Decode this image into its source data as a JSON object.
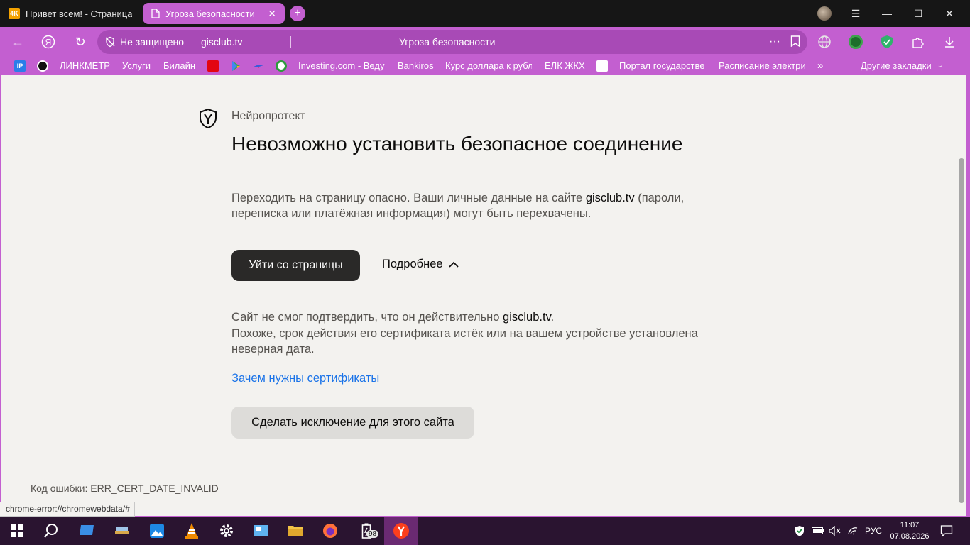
{
  "tabs": [
    {
      "title": "Привет всем! - Страница",
      "active": false
    },
    {
      "title": "Угроза безопасности",
      "active": true
    }
  ],
  "toolbar": {
    "security_label": "Не защищено",
    "url": "gisclub.tv",
    "page_title": "Угроза безопасности",
    "menu_dots": "···"
  },
  "bookmarks": [
    {
      "label": "IP",
      "icon": "ip-icon"
    },
    {
      "label": "",
      "icon": "speedometer-icon"
    },
    {
      "label": "ЛИНКМЕТР",
      "icon": ""
    },
    {
      "label": "Услуги",
      "icon": ""
    },
    {
      "label": "Билайн",
      "icon": ""
    },
    {
      "label": "",
      "icon": "mts-icon"
    },
    {
      "label": "",
      "icon": "play-icon"
    },
    {
      "label": "",
      "icon": "bird-icon"
    },
    {
      "label": "",
      "icon": "flower-icon"
    },
    {
      "label": "Investing.com - Веду",
      "icon": ""
    },
    {
      "label": "Bankiros",
      "icon": ""
    },
    {
      "label": "Курс доллара к рубл",
      "icon": ""
    },
    {
      "label": "ЕЛК ЖКХ",
      "icon": ""
    },
    {
      "label": "Портал государстве",
      "icon": "gosuslugi-icon"
    },
    {
      "label": "Расписание электри",
      "icon": ""
    }
  ],
  "bookmarks_more": "»",
  "other_bookmarks": "Другие закладки",
  "page": {
    "brand": "Нейропротект",
    "heading": "Невозможно установить безопасное соединение",
    "para_before": "Переходить на страницу опасно. Ваши личные данные на сайте ",
    "para_domain": "gisclub.tv",
    "para_after": " (пароли, переписка или платёжная информация) могут быть перехвачены.",
    "leave_button": "Уйти со страницы",
    "details_toggle": "Подробнее",
    "detail_line1_before": "Сайт не смог подтвердить, что он действительно ",
    "detail_domain": "gisclub.tv",
    "detail_line1_after": ".",
    "detail_line2": "Похоже, срок действия его сертификата истёк или на вашем устройстве установлена неверная дата.",
    "cert_link": "Зачем нужны сертификаты",
    "exception_button": "Сделать исключение для этого сайта",
    "error_code": "Код ошибки: ERR_CERT_DATE_INVALID"
  },
  "status_url": "chrome-error://chromewebdata/#",
  "taskbar": {
    "badge_count": "98",
    "lang": "РУС",
    "time": "11:07",
    "date": "07.08.2026"
  },
  "colors": {
    "accent": "#c35fd0",
    "page_bg": "#f3f2ef",
    "link": "#1a73e8",
    "primary_button": "#2a2928"
  }
}
